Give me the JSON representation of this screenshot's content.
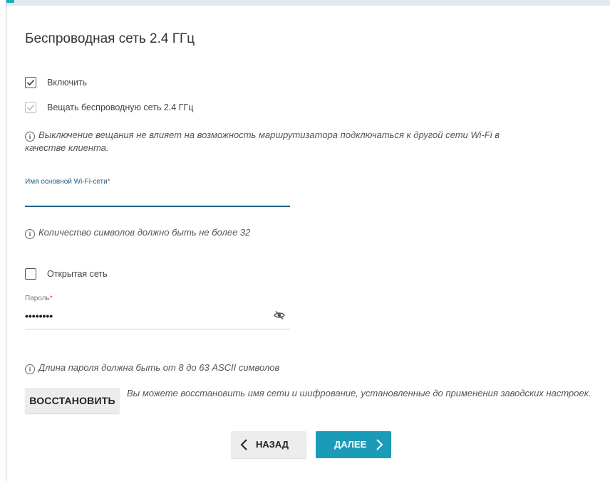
{
  "section": {
    "title": "Беспроводная сеть 2.4 ГГц"
  },
  "enable": {
    "label": "Включить",
    "checked": true
  },
  "broadcast": {
    "label": "Вещать беспроводную сеть 2.4 ГГц",
    "checked": true,
    "disabled": true
  },
  "broadcast_note": {
    "icon": "info-icon",
    "line1": "Выключение вещания не влияет на возможность маршрутизатора подключаться к другой сети Wi-Fi в",
    "line2": "качестве клиента."
  },
  "ssid": {
    "label": "Имя основной Wi-Fi-сети",
    "required_mark": "*",
    "value": "",
    "note": "Количество символов должно быть не более 32"
  },
  "open_network": {
    "label": "Открытая сеть",
    "checked": false
  },
  "password": {
    "label": "Пароль",
    "required_mark": "*",
    "value": "••••••••",
    "toggle_icon": "eye-slash-icon",
    "note": "Длина пароля должна быть от 8 до 63 ASCII символов"
  },
  "restore": {
    "button_label": "ВОССТАНОВИТЬ",
    "description": "Вы можете восстановить имя сети и шифрование, установленные до применения заводских настроек."
  },
  "nav": {
    "back_label": "НАЗАД",
    "next_label": "ДАЛЕЕ"
  },
  "colors": {
    "accent": "#1a9cb8",
    "field_label_active": "#1a5f8a",
    "required": "#e03b3b"
  }
}
